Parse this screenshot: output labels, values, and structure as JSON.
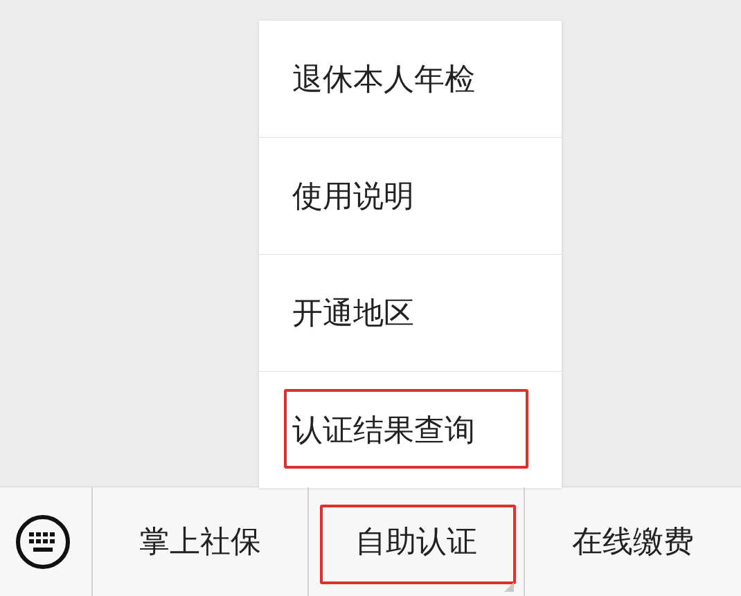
{
  "menu_popup": {
    "items": [
      {
        "label": "退休本人年检",
        "annotated": false
      },
      {
        "label": "使用说明",
        "annotated": false
      },
      {
        "label": "开通地区",
        "annotated": false
      },
      {
        "label": "认证结果查询",
        "annotated": true
      }
    ]
  },
  "bottom_bar": {
    "tabs": [
      {
        "label": "掌上社保",
        "annotated": false,
        "has_submenu": false
      },
      {
        "label": "自助认证",
        "annotated": true,
        "has_submenu": true
      },
      {
        "label": "在线缴费",
        "annotated": false,
        "has_submenu": false
      }
    ]
  }
}
